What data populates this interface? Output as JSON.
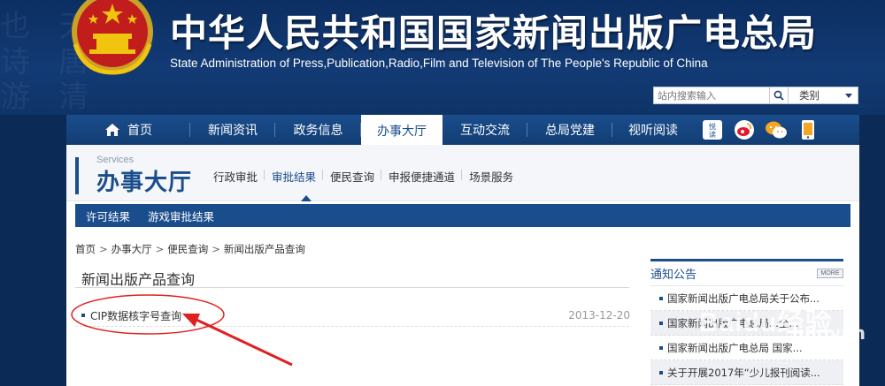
{
  "header": {
    "title": "中华人民共和国国家新闻出版广电总局",
    "subtitle": "State Administration of Press,Publication,Radio,Film and Television of The People's Republic of China",
    "emblem_icon": "national-emblem-icon"
  },
  "search": {
    "placeholder": "站内搜索输入",
    "button_icon": "search-icon",
    "category_label": "类别"
  },
  "nav": {
    "home": "首页",
    "items": [
      "新闻资讯",
      "政务信息",
      "办事大厅",
      "互动交流",
      "总局党建",
      "视听阅读"
    ],
    "active_index": 2,
    "icons": [
      "yuedu-icon",
      "weibo-icon",
      "wechat-icon",
      "mobile-icon"
    ],
    "icon_labels": {
      "yuedu": "悦读"
    }
  },
  "section": {
    "label": "Services",
    "title": "办事大厅",
    "sub_nav": [
      "行政审批",
      "审批结果",
      "便民查询",
      "申报便捷通道",
      "场景服务"
    ],
    "active_sub_index": 1
  },
  "tab_strip": [
    "许可结果",
    "游戏审批结果"
  ],
  "breadcrumb": [
    "首页",
    "办事大厅",
    "便民查询",
    "新闻出版产品查询"
  ],
  "breadcrumb_separator": ">",
  "main": {
    "title": "新闻出版产品查询",
    "items": [
      {
        "label": "CIP数据核字号查询",
        "date": "2013-12-20"
      }
    ]
  },
  "sidebar": {
    "title": "通知公告",
    "more_label": "MORE",
    "notices": [
      "国家新闻出版广电总局关于公布...",
      "国家新闻出版广电总局...全...",
      "国家新闻出版广电总局 国家...",
      "关于开展2017年“少儿报刊阅读..."
    ]
  },
  "watermark": {
    "text": "Baidu经验",
    "sub": "jingyan"
  },
  "colors": {
    "brand_blue": "#1a4d8c",
    "header_bg": "#0c2f63",
    "annotation_red": "#e02020"
  }
}
